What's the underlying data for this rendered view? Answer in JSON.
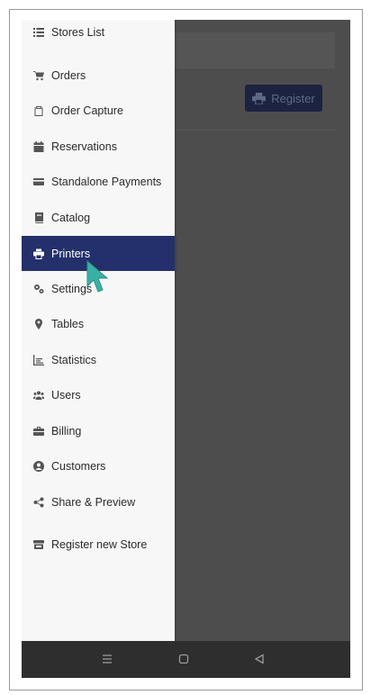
{
  "background": {
    "register_label": "Register"
  },
  "drawer": {
    "active_color": "#23306b",
    "items": [
      {
        "label": "Stores List",
        "icon": "list-icon"
      },
      {
        "label": "Orders",
        "icon": "cart-icon"
      },
      {
        "label": "Order Capture",
        "icon": "clipboard-icon"
      },
      {
        "label": "Reservations",
        "icon": "calendar-icon"
      },
      {
        "label": "Standalone Payments",
        "icon": "credit-card-icon"
      },
      {
        "label": "Catalog",
        "icon": "book-icon"
      },
      {
        "label": "Printers",
        "icon": "printer-icon",
        "active": true
      },
      {
        "label": "Settings",
        "icon": "gears-icon"
      },
      {
        "label": "Tables",
        "icon": "map-pin-icon"
      },
      {
        "label": "Statistics",
        "icon": "chart-icon"
      },
      {
        "label": "Users",
        "icon": "users-icon"
      },
      {
        "label": "Billing",
        "icon": "briefcase-icon"
      },
      {
        "label": "Customers",
        "icon": "user-circle-icon"
      },
      {
        "label": "Share & Preview",
        "icon": "share-icon"
      },
      {
        "label": "Register new Store",
        "icon": "store-icon"
      }
    ]
  },
  "system_nav": {
    "menu_icon": "menu-icon",
    "home_icon": "home-square-icon",
    "back_icon": "back-triangle-icon"
  }
}
